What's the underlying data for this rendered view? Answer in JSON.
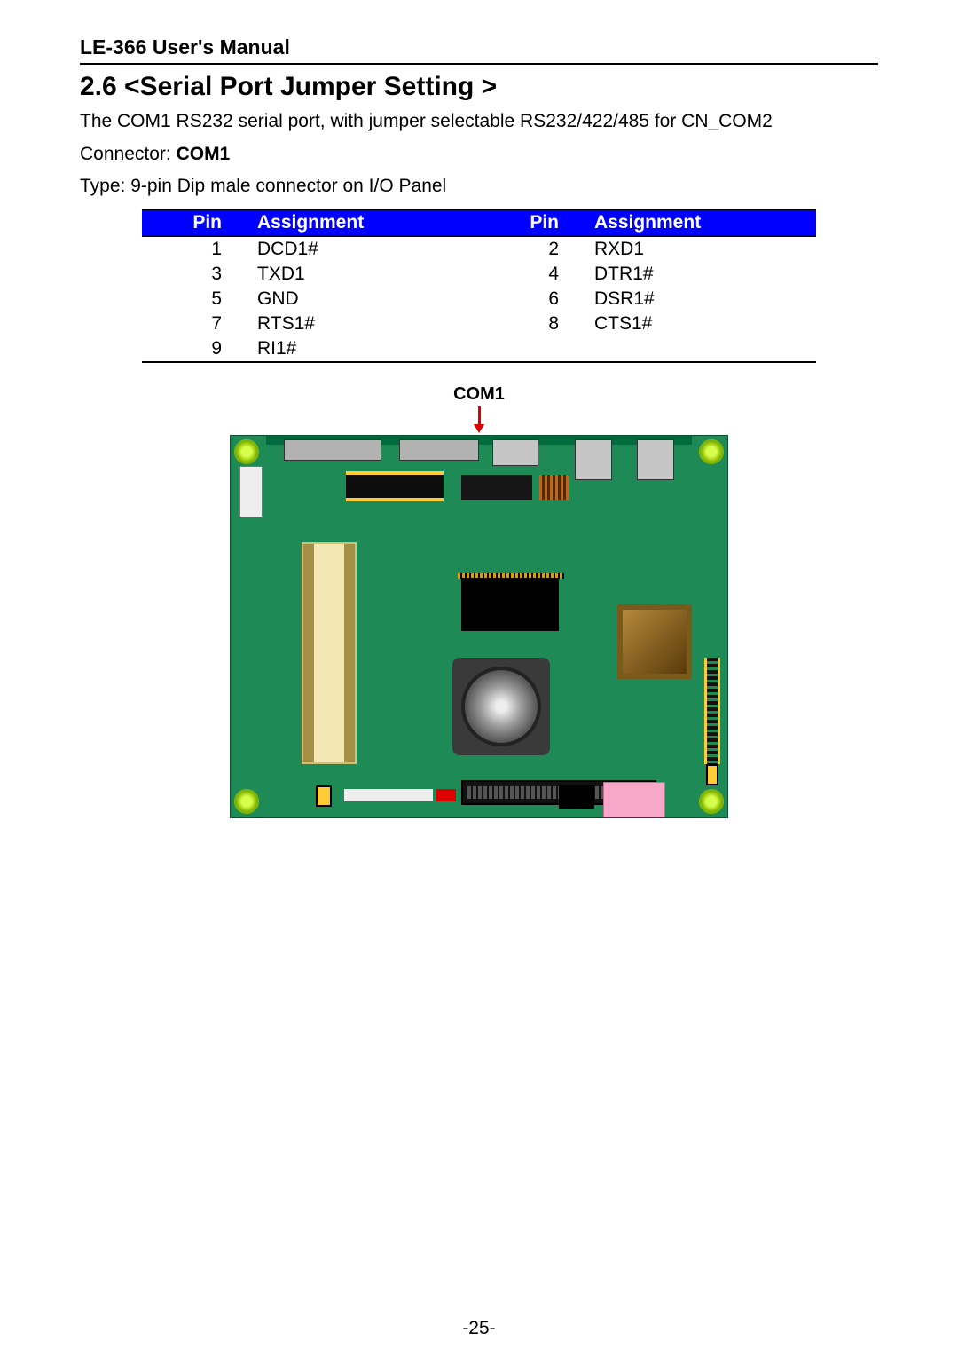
{
  "header": {
    "manual_title": "LE-366 User's Manual"
  },
  "section": {
    "title": "2.6 <Serial Port Jumper Setting >",
    "intro": "The COM1 RS232 serial port, with jumper selectable RS232/422/485 for CN_COM2",
    "connector_prefix": "Connector: ",
    "connector_name": "COM1",
    "type_line": "Type: 9-pin Dip male connector on I/O Panel"
  },
  "pin_table": {
    "headers": {
      "pin": "Pin",
      "assignment": "Assignment"
    },
    "rows": [
      {
        "p1": "1",
        "a1": "DCD1#",
        "p2": "2",
        "a2": "RXD1"
      },
      {
        "p1": "3",
        "a1": "TXD1",
        "p2": "4",
        "a2": "DTR1#"
      },
      {
        "p1": "5",
        "a1": "GND",
        "p2": "6",
        "a2": "DSR1#"
      },
      {
        "p1": "7",
        "a1": "RTS1#",
        "p2": "8",
        "a2": "CTS1#"
      },
      {
        "p1": "9",
        "a1": "RI1#",
        "p2": "",
        "a2": ""
      }
    ]
  },
  "figure": {
    "callout": "COM1"
  },
  "page": {
    "number": "-25-"
  }
}
